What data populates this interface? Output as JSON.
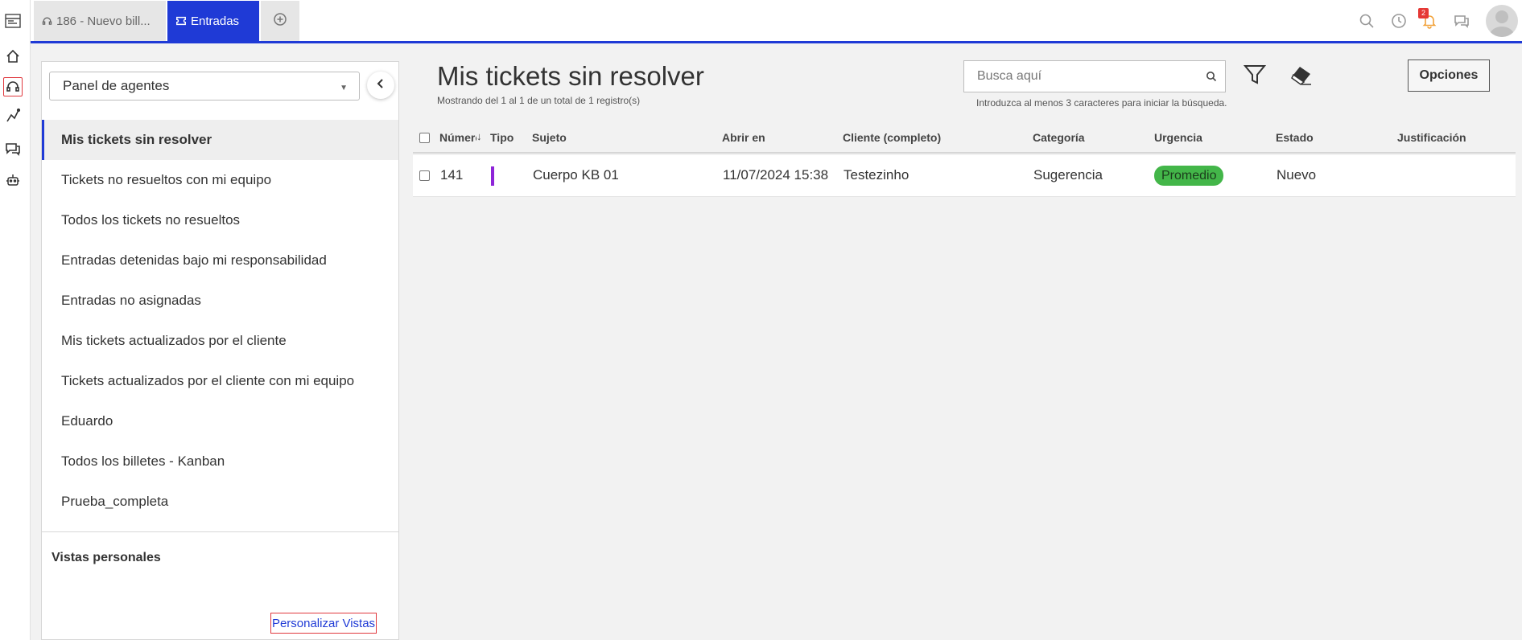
{
  "tabs": [
    {
      "label": "186 - Nuevo bill..."
    },
    {
      "label": "Entradas"
    }
  ],
  "notifications": {
    "count": "2"
  },
  "sidebar": {
    "panel_select": "Panel de agentes",
    "views": [
      {
        "label": "Mis tickets sin resolver"
      },
      {
        "label": "Tickets no resueltos con mi equipo"
      },
      {
        "label": "Todos los tickets no resueltos"
      },
      {
        "label": "Entradas detenidas bajo mi responsabilidad"
      },
      {
        "label": "Entradas no asignadas"
      },
      {
        "label": "Mis tickets actualizados por el cliente"
      },
      {
        "label": "Tickets actualizados por el cliente con mi equipo"
      },
      {
        "label": "Eduardo"
      },
      {
        "label": "Todos los billetes - Kanban"
      },
      {
        "label": "Prueba_completa"
      }
    ],
    "personal_views_title": "Vistas personales",
    "customize_label": "Personalizar Vistas"
  },
  "main": {
    "title": "Mis tickets sin resolver",
    "subtitle": "Mostrando del 1 al 1 de un total de 1 registro(s)",
    "search_placeholder": "Busca aquí",
    "search_hint": "Introduzca al menos 3 caracteres para iniciar la búsqueda.",
    "options_label": "Opciones"
  },
  "table": {
    "columns": [
      "Número",
      "Tipo",
      "Sujeto",
      "Abrir en",
      "Cliente (completo)",
      "Categoría",
      "Urgencia",
      "Estado",
      "Justificación"
    ],
    "rows": [
      {
        "number": "141",
        "type_color": "#8e24d8",
        "subject": "Cuerpo KB 01",
        "opened": "11/07/2024 15:38",
        "client": "Testezinho",
        "category": "Sugerencia",
        "urgency": "Promedio",
        "status": "Nuevo",
        "justification": ""
      }
    ]
  }
}
